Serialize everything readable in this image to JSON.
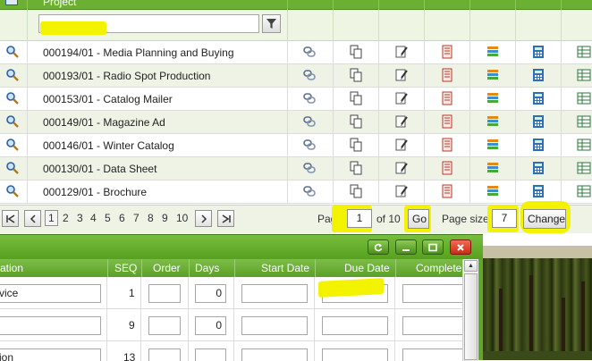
{
  "grid": {
    "header_label": "Project",
    "filter_value": "",
    "rows": [
      {
        "name": "000194/01 - Media Planning and Buying"
      },
      {
        "name": "000193/01 - Radio Spot Production"
      },
      {
        "name": "000153/01 - Catalog Mailer"
      },
      {
        "name": "000149/01 - Magazine Ad"
      },
      {
        "name": "000146/01 - Winter Catalog"
      },
      {
        "name": "000130/01 - Data Sheet"
      },
      {
        "name": "000129/01 - Brochure"
      }
    ],
    "row_icons": [
      "search-icon",
      "link-icon",
      "copy-icon",
      "edit-document-icon",
      "report-icon",
      "stack-icon",
      "calculator-icon",
      "grid-icon"
    ]
  },
  "pager": {
    "first": "|<",
    "prev": "<",
    "pages": [
      "1",
      "2",
      "3",
      "4",
      "5",
      "6",
      "7",
      "8",
      "9",
      "10"
    ],
    "next": ">",
    "last": ">|",
    "page_label": "Page:",
    "page_value": "1",
    "of_label": "of 10",
    "go_label": "Go",
    "page_size_label": "Page size:",
    "page_size_value": "7",
    "change_label": "Change"
  },
  "dialog": {
    "columns": [
      "ation",
      "SEQ",
      "Order",
      "Days",
      "Start Date",
      "Due Date",
      "Complete"
    ],
    "rows": [
      {
        "description": "vice",
        "seq": "1",
        "order": "",
        "days": "0",
        "start_date": "",
        "due_date": "",
        "complete": ""
      },
      {
        "description": "",
        "seq": "9",
        "order": "",
        "days": "0",
        "start_date": "",
        "due_date": "",
        "complete": ""
      },
      {
        "description": "ion",
        "seq": "13",
        "order": "",
        "days": "",
        "start_date": "",
        "due_date": "",
        "complete": ""
      }
    ]
  },
  "colors": {
    "accent_green": "#6cb033",
    "highlight_yellow": "#f3f300"
  }
}
